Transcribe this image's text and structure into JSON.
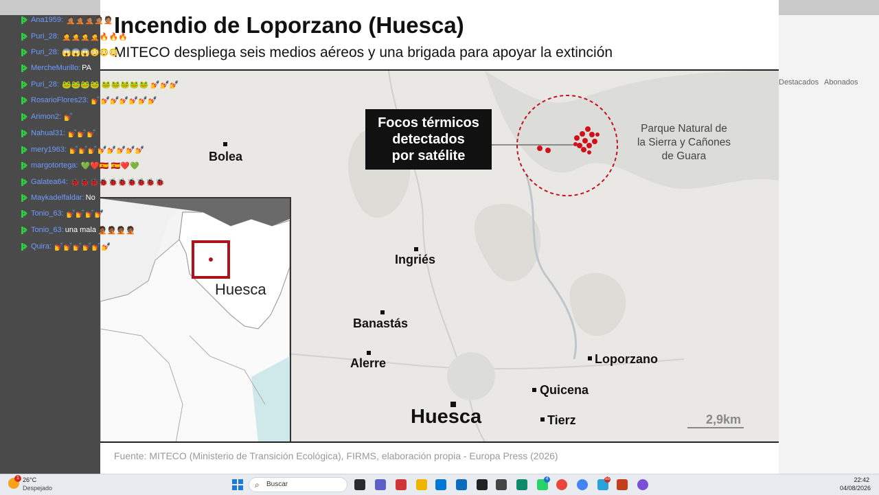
{
  "slide": {
    "title": "Incendio de Loporzano (Huesca)",
    "subtitle": "MITECO despliega seis medios aéreos y una brigada para apoyar la extinción",
    "callout": [
      "Focos térmicos",
      "detectados",
      "por satélite"
    ],
    "park_label": [
      "Parque Natural de",
      "la Sierra y Cañones",
      "de Guara"
    ],
    "towns": {
      "bolea": "Bolea",
      "ingries": "Ingriés",
      "banastas": "Banastás",
      "alerre": "Alerre",
      "loporzano": "Loporzano",
      "quicena": "Quicena",
      "tierz": "Tierz"
    },
    "city": "Huesca",
    "inset_label": "Huesca",
    "scale": "2,9km",
    "source": "Fuente: MITECO (Ministerio de Transición Ecológica), FIRMS, elaboración propia - Europa Press (2026)",
    "colors": {
      "fire": "#d0101c",
      "callout_bg": "#111111",
      "map_bg": "#e9e8e4"
    }
  },
  "chat": {
    "messages": [
      {
        "user": "Ana1959:",
        "text": "",
        "emoji": "🤦🏽🤦🏽🤦🏽🤦🏽🤦🏽"
      },
      {
        "user": "Puri_28:",
        "text": "",
        "emoji": "🤦🤦🤦🤦🔥🔥🔥"
      },
      {
        "user": "Puri_28:",
        "text": "",
        "emoji": "😱😱😱😳😳😳"
      },
      {
        "user": "MercheMurillo:",
        "text": "PA",
        "emoji": ""
      },
      {
        "user": "Puri_28:",
        "text": "",
        "emoji": "🐸🐸🐸🐸 🐸🐸🐸🐸🐸 💅💅💅"
      },
      {
        "user": "RosarioFlores23:",
        "text": "",
        "emoji": "💅💅💅💅💅💅💅"
      },
      {
        "user": "Arimon2:",
        "text": "",
        "emoji": "💅"
      },
      {
        "user": "Nahual31:",
        "text": "",
        "emoji": "💅💅💅"
      },
      {
        "user": "mery1963:",
        "text": "",
        "emoji": "💅💅💅💅💅💅💅💅"
      },
      {
        "user": "margotortega:",
        "text": "",
        "emoji": "💚❤️🇪🇸 🇪🇸❤️💚"
      },
      {
        "user": "Galatea64:",
        "text": "",
        "emoji": "🐞🐞🐞🐞🐞🐞🐞🐞🐞🐞"
      },
      {
        "user": "Maykadelfaldar:",
        "text": "No",
        "emoji": ""
      },
      {
        "user": "Tonio_63:",
        "text": "",
        "emoji": "💅💅💅💅"
      },
      {
        "user": "Tonio_63:",
        "text": "una mala",
        "emoji": "🤦🏾🤦🏾🤦🏾🤦🏾"
      },
      {
        "user": "Quira:",
        "text": "",
        "emoji": "💅💅💅💅💅💅"
      }
    ]
  },
  "background": {
    "tab_a": "Destacados",
    "tab_b": "Abonados"
  },
  "taskbar": {
    "weather_temp": "26°C",
    "weather_desc": "Despejado",
    "weather_badge": "1",
    "search_placeholder": "Buscar",
    "time": "22:42",
    "date": "04/08/2026",
    "icons": [
      "task-view-icon",
      "teams-icon",
      "app-icon",
      "file-explorer-icon",
      "store-icon",
      "outlook-icon",
      "app-icon-2",
      "app-icon-3",
      "edge-icon",
      "whatsapp-icon",
      "chrome-icon",
      "chrome-alt-icon",
      "telegram-icon",
      "powerpoint-icon",
      "app-icon-4"
    ],
    "badges": {
      "whatsapp": "4",
      "telegram": "55"
    }
  }
}
